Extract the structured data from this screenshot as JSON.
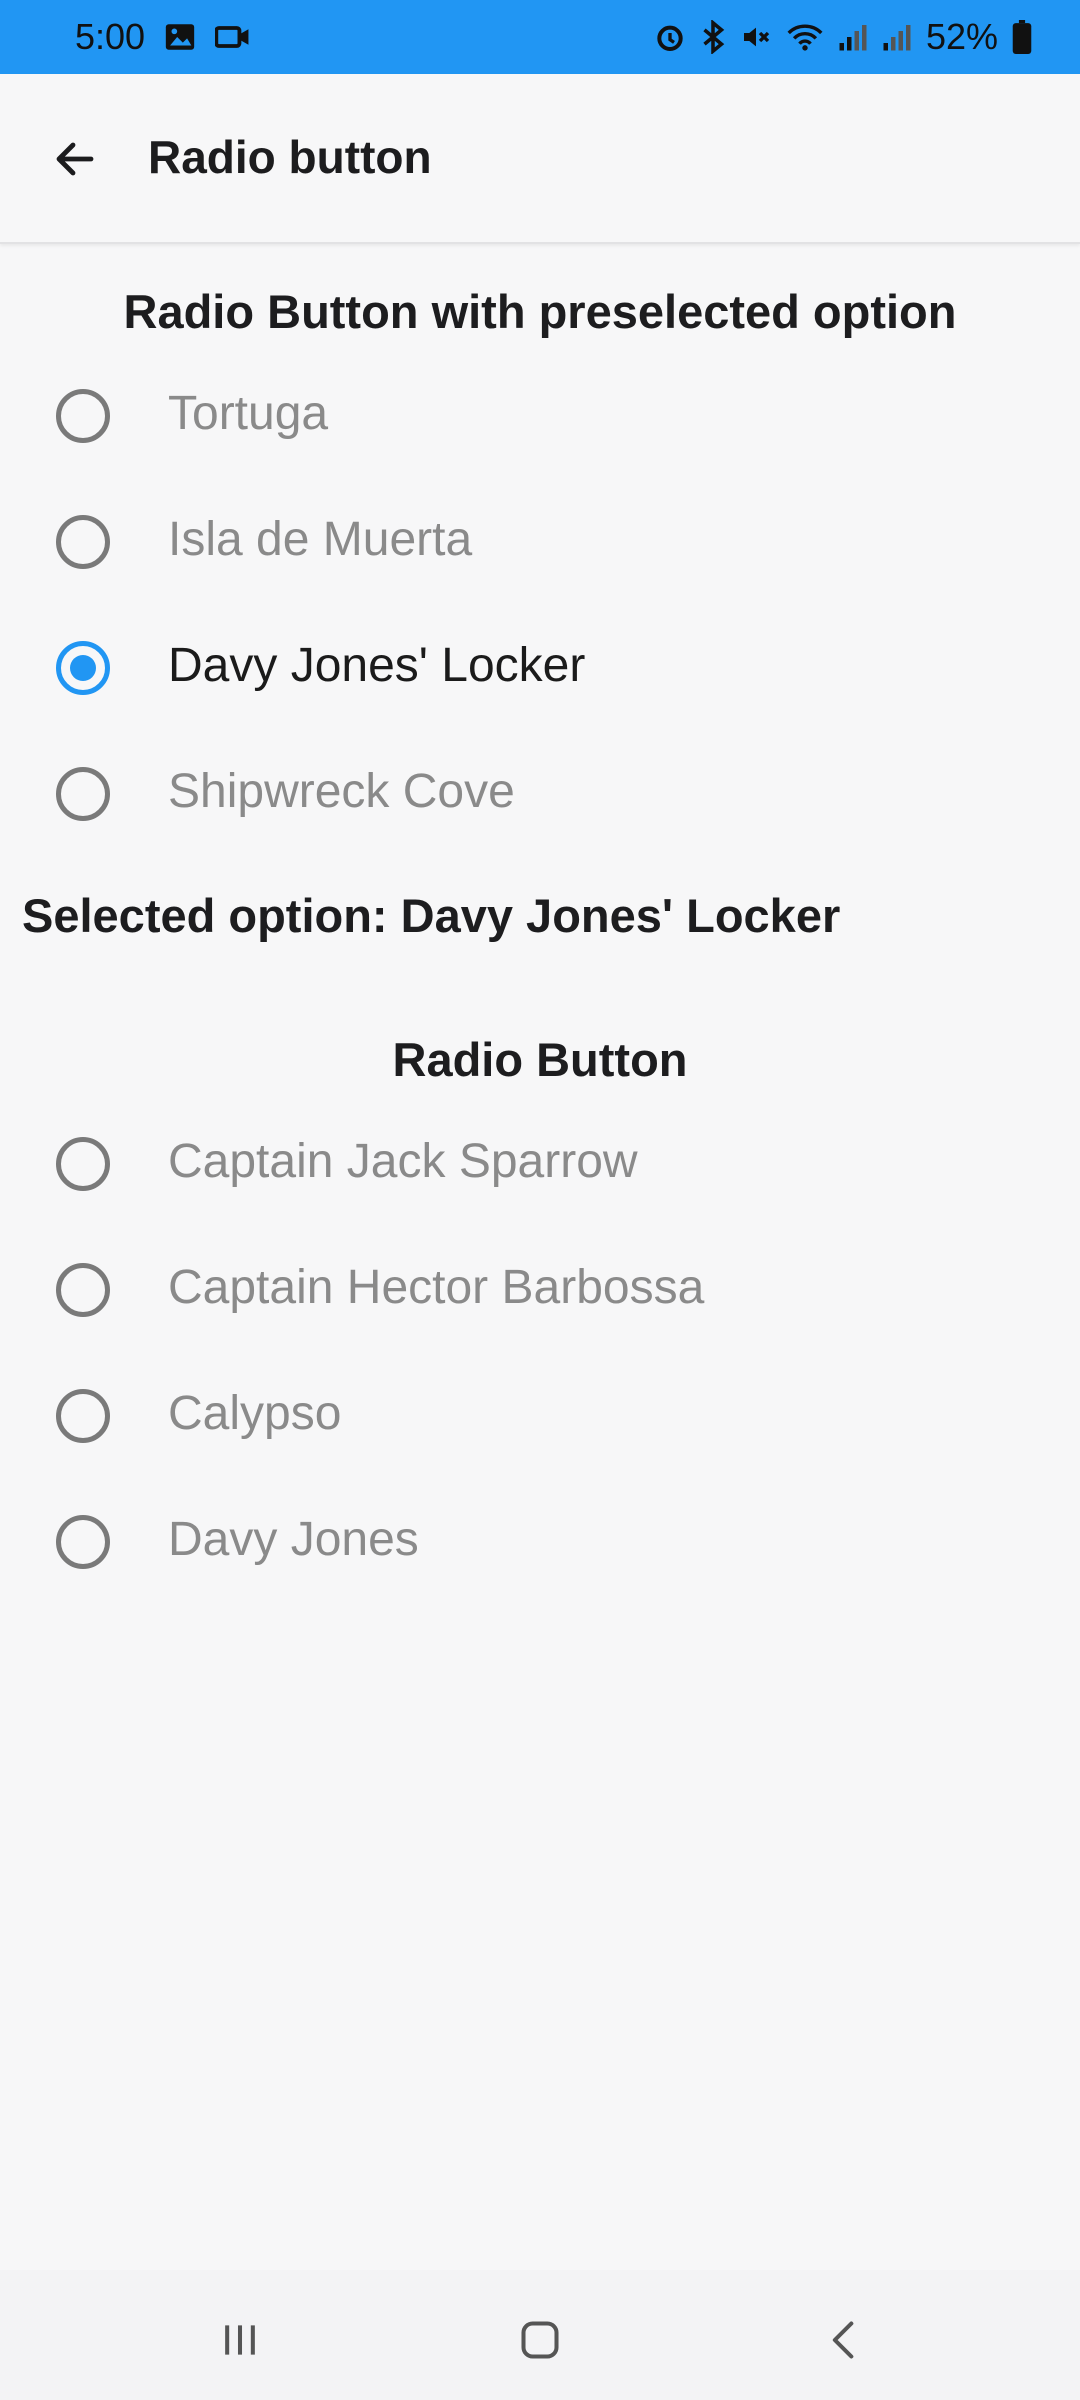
{
  "status_bar": {
    "time": "5:00",
    "battery": "52%",
    "icons_left": [
      "gallery-icon",
      "video-camera-icon"
    ],
    "icons_right": [
      "alarm-icon",
      "bluetooth-icon",
      "mute-icon",
      "wifi-icon",
      "signal-icon",
      "signal-icon",
      "battery-icon"
    ]
  },
  "app_bar": {
    "title": "Radio button"
  },
  "section1": {
    "title": "Radio Button with preselected option",
    "options": [
      "Tortuga",
      "Isla de Muerta",
      "Davy Jones' Locker",
      "Shipwreck Cove"
    ],
    "selected_index": 2
  },
  "selected_text": "Selected option: Davy Jones' Locker",
  "section2": {
    "title": "Radio Button",
    "options": [
      "Captain Jack Sparrow",
      "Captain Hector Barbossa",
      "Calypso",
      "Davy Jones"
    ]
  },
  "colors": {
    "accent": "#2196f3",
    "unselected_text": "#8a8a8a",
    "selected_text": "#1b1b1b"
  }
}
